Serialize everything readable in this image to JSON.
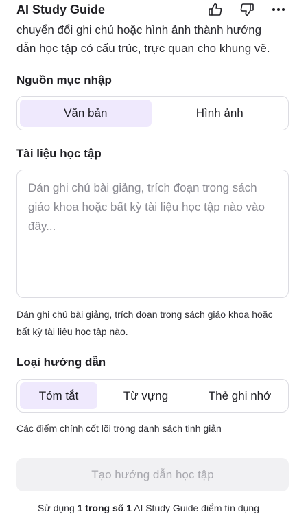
{
  "header": {
    "title": "AI Study Guide",
    "icons": [
      "thumbs-up-icon",
      "thumbs-down-icon",
      "more-icon"
    ]
  },
  "description": "chuyển đổi ghi chú hoặc hình ảnh thành hướng dẫn học tập có cấu trúc, trực quan cho khung vẽ.",
  "source": {
    "label": "Nguồn mục nhập",
    "options": [
      "Văn bản",
      "Hình ảnh"
    ],
    "selected": "Văn bản"
  },
  "material": {
    "label": "Tài liệu học tập",
    "placeholder": "Dán ghi chú bài giảng, trích đoạn trong sách giáo khoa hoặc bất kỳ tài liệu học tập nào vào đây...",
    "value": "",
    "helper": "Dán ghi chú bài giảng, trích đoạn trong sách giáo khoa hoặc bất kỳ tài liệu học tập nào."
  },
  "guide_type": {
    "label": "Loại hướng dẫn",
    "options": [
      "Tóm tắt",
      "Từ vựng",
      "Thẻ ghi nhớ"
    ],
    "selected": "Tóm tắt",
    "helper": "Các điểm chính cốt lõi trong danh sách tinh giản"
  },
  "submit_label": "Tạo hướng dẫn học tập",
  "credits": {
    "prefix": "Sử dụng ",
    "amount": "1 trong số 1",
    "suffix": " AI Study Guide điểm tín dụng"
  },
  "colors": {
    "accent_bg": "#efe9fd",
    "link": "#5b3fd6",
    "disabled_text": "#a8a8ae"
  }
}
